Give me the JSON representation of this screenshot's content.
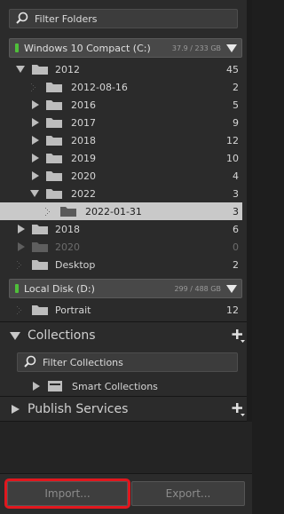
{
  "folders": {
    "search_placeholder": "Filter Folders",
    "volumes": [
      {
        "name": "Windows 10 Compact (C:)",
        "size": "37.9 / 233 GB",
        "status_color": "#4fbf3a"
      },
      {
        "name": "Local Disk (D:)",
        "size": "299 / 488 GB",
        "status_color": "#4fbf3a"
      }
    ],
    "tree": [
      {
        "label": "2012",
        "count": "45"
      },
      {
        "label": "2012-08-16",
        "count": "2"
      },
      {
        "label": "2016",
        "count": "5"
      },
      {
        "label": "2017",
        "count": "9"
      },
      {
        "label": "2018",
        "count": "12"
      },
      {
        "label": "2019",
        "count": "10"
      },
      {
        "label": "2020",
        "count": "4"
      },
      {
        "label": "2022",
        "count": "3"
      },
      {
        "label": "2022-01-31",
        "count": "3"
      },
      {
        "label": "2018",
        "count": "6"
      },
      {
        "label": "2020",
        "count": "0"
      },
      {
        "label": "Desktop",
        "count": "2"
      },
      {
        "label": "Portrait",
        "count": "12"
      }
    ]
  },
  "collections": {
    "title": "Collections",
    "search_placeholder": "Filter Collections",
    "items": [
      {
        "label": "Smart Collections"
      }
    ]
  },
  "publish": {
    "title": "Publish Services"
  },
  "buttons": {
    "import_label": "Import...",
    "export_label": "Export..."
  },
  "colors": {
    "highlight_outline": "#e1171e",
    "selected_row": "#c9c9c9",
    "panel_bg": "#2b2b2b"
  }
}
